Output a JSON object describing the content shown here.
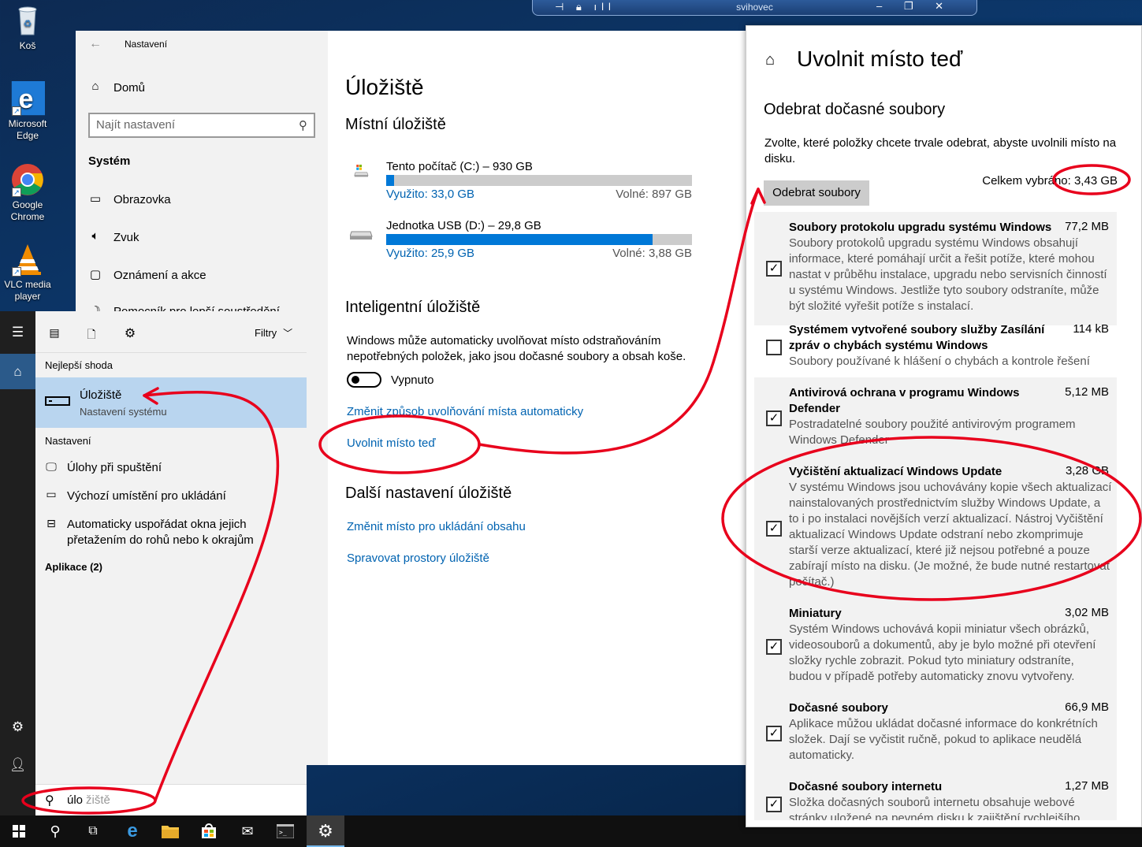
{
  "desktop": {
    "icons": [
      {
        "label": "Koš",
        "icon": "recycle-bin-icon"
      },
      {
        "label": "Microsoft Edge",
        "icon": "edge-icon"
      },
      {
        "label": "Google Chrome",
        "icon": "chrome-icon"
      },
      {
        "label": "VLC media player",
        "icon": "vlc-icon"
      }
    ]
  },
  "rdp_bar": {
    "title": "svihovec"
  },
  "settings": {
    "window_title": "Nastavení",
    "home": "Domů",
    "search_placeholder": "Najít nastavení",
    "section": "Systém",
    "nav": [
      {
        "label": "Obrazovka",
        "icon": "monitor-icon"
      },
      {
        "label": "Zvuk",
        "icon": "speaker-icon"
      },
      {
        "label": "Oznámení a akce",
        "icon": "notification-icon"
      },
      {
        "label": "Pomocník pro lepší soustředění",
        "icon": "moon-icon"
      }
    ],
    "page_title": "Úložiště",
    "local_storage_heading": "Místní úložiště",
    "drives": [
      {
        "name": "Tento počítač (C:) – 930 GB",
        "used": "Využito: 33,0 GB",
        "free": "Volné: 897 GB",
        "fill": 0.026
      },
      {
        "name": "Jednotka USB (D:) – 29,8 GB",
        "used": "Využito: 25,9 GB",
        "free": "Volné: 3,88 GB",
        "fill": 0.87
      }
    ],
    "smart_heading": "Inteligentní úložiště",
    "smart_desc_1": "Windows může automaticky uvolňovat místo odstraňováním",
    "smart_desc_2": "nepotřebných položek, jako jsou dočasné soubory a obsah koše.",
    "toggle_label": "Vypnuto",
    "link_change_auto": "Změnit způsob uvolňování místa automaticky",
    "link_free_now": "Uvolnit místo teď",
    "more_heading": "Další nastavení úložiště",
    "link_change_location": "Změnit místo pro ukládání obsahu",
    "link_manage_spaces": "Spravovat prostory úložiště"
  },
  "start_menu": {
    "filters": "Filtry",
    "best_match_heading": "Nejlepší shoda",
    "best_match_title": "Úložiště",
    "best_match_sub": "Nastavení systému",
    "settings_heading": "Nastavení",
    "results": [
      "Úlohy při spuštění",
      "Výchozí umístění pro ukládání",
      "Automaticky uspořádat okna jejich",
      "přetažením do rohů nebo k okrajům"
    ],
    "apps_heading": "Aplikace (2)",
    "search_typed": "úlo",
    "search_suggest": "žiště"
  },
  "cleanup": {
    "title": "Uvolnit místo teď",
    "subtitle": "Odebrat dočasné soubory",
    "desc_1": "Zvolte, které položky chcete trvale odebrat, abyste uvolnili místo na",
    "desc_2": "disku.",
    "button": "Odebrat soubory",
    "total": "Celkem vybráno: 3,43 GB",
    "items": [
      {
        "title": [
          "Soubory protokolu upgradu systému Windows"
        ],
        "size": "77,2 MB",
        "checked": true,
        "desc": [
          "Soubory protokolů upgradu systému Windows obsahují",
          "informace, které pomáhají určit a řešit potíže, které mohou",
          "nastat v průběhu instalace, upgradu nebo servisních činností",
          "u systému Windows. Jestliže tyto soubory odstraníte, může",
          "být složité vyřešit potíže s instalací."
        ]
      },
      {
        "title": [
          "Systémem vytvořené soubory služby Zasílání",
          "zpráv o chybách systému Windows"
        ],
        "size": "114 kB",
        "checked": false,
        "desc": [
          "Soubory používané k hlášení o chybách a kontrole řešení"
        ]
      },
      {
        "title": [
          "Antivirová ochrana v programu Windows",
          "Defender"
        ],
        "size": "5,12 MB",
        "checked": true,
        "desc": [
          "Postradatelné soubory použité antivirovým programem",
          "Windows Defender"
        ]
      },
      {
        "title": [
          "Vyčištění aktualizací Windows Update"
        ],
        "size": "3,28 GB",
        "checked": true,
        "desc": [
          "V systému Windows jsou uchovávány kopie všech aktualizací",
          "nainstalovaných prostřednictvím služby Windows Update, a",
          "to i po instalaci novějších verzí aktualizací. Nástroj Vyčištění",
          "aktualizací Windows Update odstraní nebo zkomprimuje",
          "starší verze aktualizací, které již nejsou potřebné a pouze",
          "zabírají místo na disku. (Je možné, že bude nutné restartovat",
          "počítač.)"
        ]
      },
      {
        "title": [
          "Miniatury"
        ],
        "size": "3,02 MB",
        "checked": true,
        "desc": [
          "Systém Windows uchovává kopii miniatur všech obrázků,",
          "videosouborů a dokumentů, aby je bylo možné při otevření",
          "složky rychle zobrazit. Pokud tyto miniatury odstraníte,",
          "budou v případě potřeby automaticky znovu vytvořeny."
        ]
      },
      {
        "title": [
          "Dočasné soubory"
        ],
        "size": "66,9 MB",
        "checked": true,
        "desc": [
          "Aplikace můžou ukládat dočasné informace do konkrétních",
          "složek. Dají se vyčistit ručně, pokud to aplikace neudělá",
          "automaticky."
        ]
      },
      {
        "title": [
          "Dočasné soubory internetu"
        ],
        "size": "1,27 MB",
        "checked": true,
        "desc": [
          "Složka dočasných souborů internetu obsahuje webové",
          "stránky uložené na pevném disku k zajištění rychlejšího"
        ]
      }
    ]
  },
  "colors": {
    "accent": "#0078d7",
    "link": "#0063b1",
    "annotation": "#e8001c"
  }
}
